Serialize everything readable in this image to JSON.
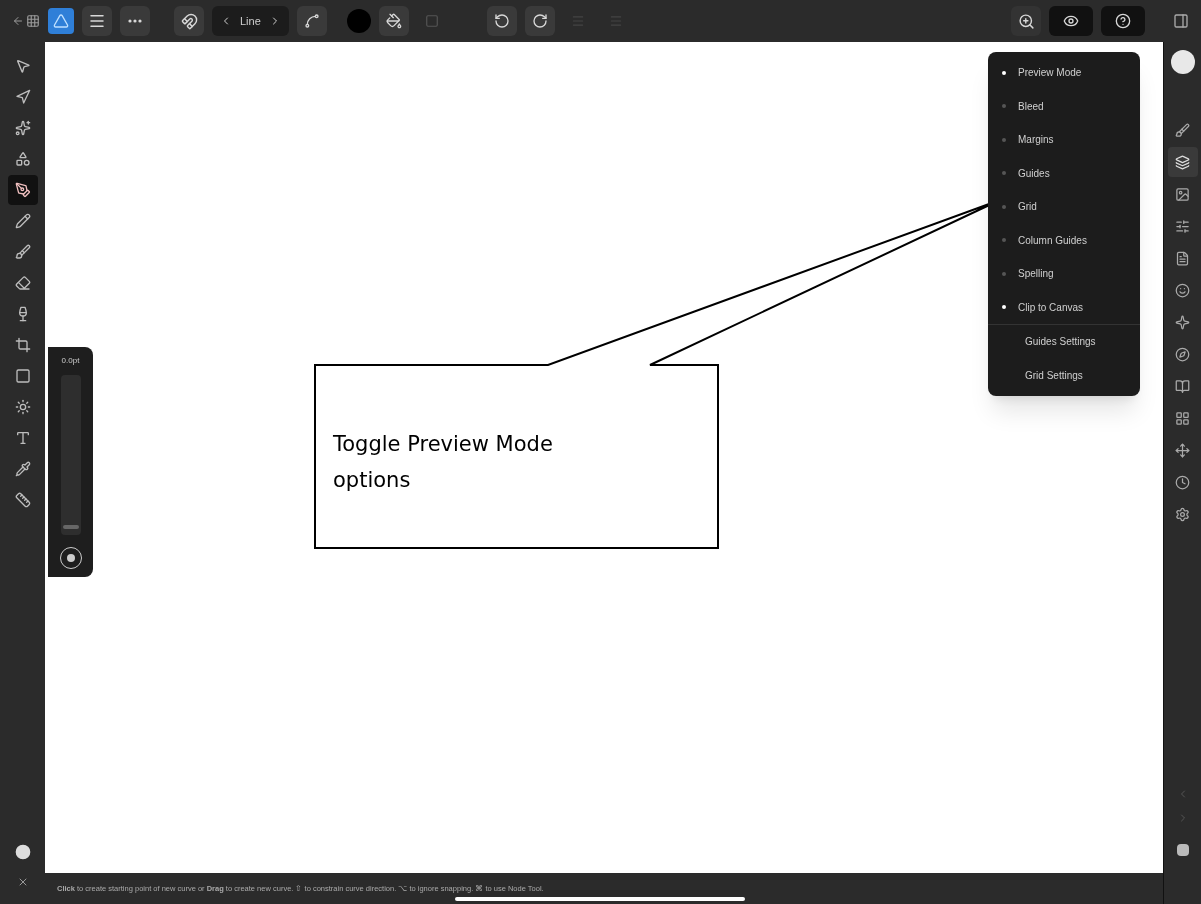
{
  "toolbar": {
    "mode_label": "Line"
  },
  "tools": [
    {
      "selected": false
    },
    {
      "selected": false
    },
    {
      "selected": false
    },
    {
      "selected": false
    },
    {
      "selected": true
    },
    {
      "selected": false
    },
    {
      "selected": false
    },
    {
      "selected": false
    },
    {
      "selected": false
    },
    {
      "selected": false
    },
    {
      "selected": false
    },
    {
      "selected": false
    },
    {
      "selected": false
    },
    {
      "selected": false
    },
    {
      "selected": false
    }
  ],
  "width_slider": {
    "reading": "0.0pt",
    "level": 0.04
  },
  "view_menu": {
    "items": [
      {
        "kind": "toggle",
        "label": "Preview Mode",
        "checked": true
      },
      {
        "kind": "toggle",
        "label": "Bleed",
        "checked": false
      },
      {
        "kind": "toggle",
        "label": "Margins",
        "checked": false
      },
      {
        "kind": "toggle",
        "label": "Guides",
        "checked": false
      },
      {
        "kind": "toggle",
        "label": "Grid",
        "checked": false
      },
      {
        "kind": "toggle",
        "label": "Column Guides",
        "checked": false
      },
      {
        "kind": "toggle",
        "label": "Spelling",
        "checked": false
      },
      {
        "kind": "toggle",
        "label": "Clip to Canvas",
        "checked": true
      },
      {
        "kind": "action",
        "label": "Guides Settings"
      },
      {
        "kind": "action",
        "label": "Grid Settings"
      }
    ]
  },
  "callout": {
    "text": "Toggle Preview Mode options"
  },
  "studio_panels": [
    {
      "selected": false
    },
    {
      "selected": true
    },
    {
      "selected": false
    },
    {
      "selected": false
    },
    {
      "selected": false
    },
    {
      "selected": false
    },
    {
      "selected": false
    },
    {
      "selected": false
    },
    {
      "selected": false
    },
    {
      "selected": false
    },
    {
      "selected": false
    },
    {
      "selected": false
    },
    {
      "selected": false
    }
  ],
  "status_bar": {
    "hint": "**Click** to create starting point of new curve or **Drag** to create new curve. ⇧ to constrain curve direction. ⌥ to ignore snapping. ⌘ to use Node Tool."
  }
}
